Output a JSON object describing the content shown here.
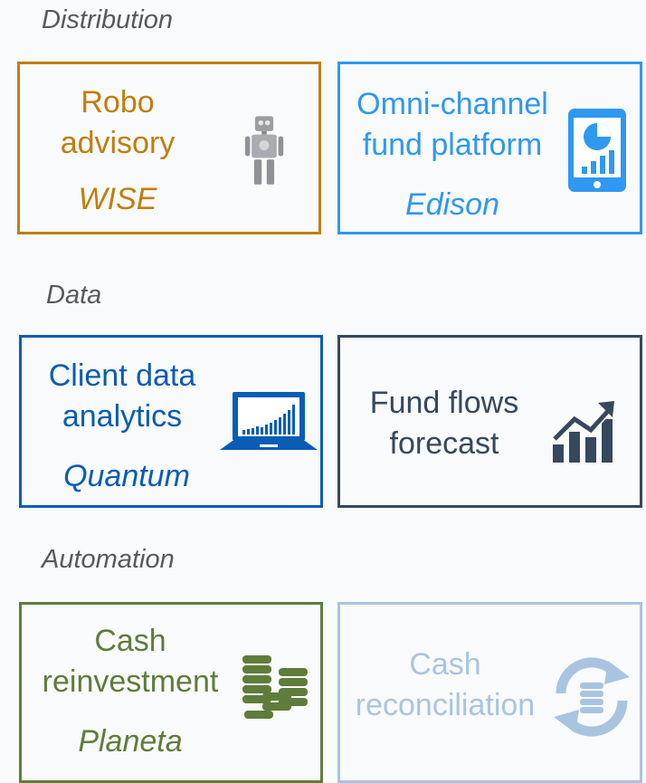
{
  "sections": {
    "distribution": "Distribution",
    "data": "Data",
    "automation": "Automation"
  },
  "cards": {
    "robo": {
      "line1": "Robo",
      "line2": "advisory",
      "name": "WISE",
      "color": "#c07e0f",
      "icon": "robot-icon"
    },
    "omni": {
      "line1": "Omni-channel",
      "line2": "fund platform",
      "name": "Edison",
      "color": "#2f98f0",
      "icon": "tablet-chart-icon"
    },
    "client": {
      "line1": "Client data",
      "line2": "analytics",
      "name": "Quantum",
      "color": "#0a5cb4",
      "icon": "laptop-chart-icon"
    },
    "flows": {
      "line1": "Fund flows",
      "line2": "forecast",
      "color": "#36485e",
      "icon": "trend-chart-icon"
    },
    "cash_reinv": {
      "line1": "Cash",
      "line2": "reinvestment",
      "name": "Planeta",
      "color": "#5f7c3a",
      "icon": "coin-stacks-icon"
    },
    "cash_recon": {
      "line1": "Cash",
      "line2": "reconciliation",
      "color": "#a9c4e0",
      "icon": "cycle-coins-icon"
    }
  }
}
